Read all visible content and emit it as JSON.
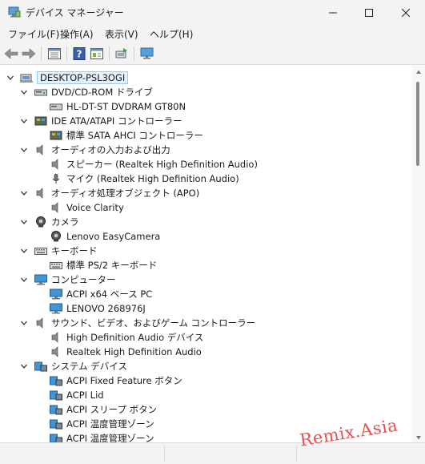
{
  "window": {
    "title": "デバイス マネージャー",
    "icon": "device-manager-icon"
  },
  "menu": [
    "ファイル(F)",
    "操作(A)",
    "表示(V)",
    "ヘルプ(H)"
  ],
  "toolbar": {
    "buttons": [
      "back-arrow-icon",
      "forward-arrow-icon",
      "properties-icon",
      "help-icon",
      "show-hidden-icon",
      "update-driver-icon",
      "scan-hardware-icon"
    ]
  },
  "tree": {
    "root": "DESKTOP-PSL3OGI",
    "categories": [
      {
        "label": "DVD/CD-ROM ドライブ",
        "icon": "dvd-drive-icon",
        "children": [
          "HL-DT-ST DVDRAM GT80N"
        ]
      },
      {
        "label": "IDE ATA/ATAPI コントローラー",
        "icon": "ide-controller-icon",
        "children": [
          "標準 SATA AHCI コントローラー"
        ]
      },
      {
        "label": "オーディオの入力および出力",
        "icon": "speaker-icon",
        "children": [
          "スピーカー (Realtek High Definition Audio)",
          "マイク (Realtek High Definition Audio)"
        ]
      },
      {
        "label": "オーディオ処理オブジェクト (APO)",
        "icon": "speaker-icon",
        "children": [
          "Voice Clarity"
        ]
      },
      {
        "label": "カメラ",
        "icon": "camera-icon",
        "children": [
          "Lenovo EasyCamera"
        ]
      },
      {
        "label": "キーボード",
        "icon": "keyboard-icon",
        "children": [
          "標準 PS/2 キーボード"
        ]
      },
      {
        "label": "コンピューター",
        "icon": "monitor-icon",
        "children": [
          "ACPI x64 ベース PC",
          "LENOVO 268976J"
        ]
      },
      {
        "label": "サウンド、ビデオ、およびゲーム コントローラー",
        "icon": "speaker-icon",
        "children": [
          "High Definition Audio デバイス",
          "Realtek High Definition Audio"
        ]
      },
      {
        "label": "システム デバイス",
        "icon": "system-folder-icon",
        "children": [
          "ACPI Fixed Feature ボタン",
          "ACPI Lid",
          "ACPI スリープ ボタン",
          "ACPI 温度管理ゾーン",
          "ACPI 温度管理ゾーン"
        ]
      }
    ]
  },
  "watermark": "Remix.Asia"
}
